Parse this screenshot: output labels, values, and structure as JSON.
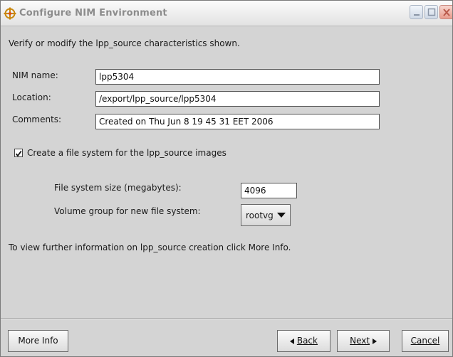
{
  "window": {
    "title": "Configure NIM Environment",
    "app_icon": "nim-icon",
    "controls": {
      "minimize": "minimize-icon",
      "maximize": "maximize-icon",
      "close": "close-icon"
    }
  },
  "instruction": "Verify or modify the lpp_source characteristics shown.",
  "form": {
    "nim_name_label": "NIM name:",
    "nim_name_value": "lpp5304",
    "location_label": "Location:",
    "location_value": "/export/lpp_source/lpp5304",
    "comments_label": "Comments:",
    "comments_value": "Created on Thu Jun 8 19 45 31 EET 2006"
  },
  "filesystem": {
    "checkbox_label": "Create a file system for the lpp_source images",
    "checked": true,
    "size_label": "File system size (megabytes):",
    "size_value": "4096",
    "volume_group_label": "Volume group for new file system:",
    "volume_group_value": "rootvg"
  },
  "info_text": "To view further information on lpp_source creation click More Info.",
  "buttons": {
    "more_info": "More Info",
    "back": "Back",
    "next": "Next",
    "cancel": "Cancel"
  },
  "colors": {
    "background": "#d4d4d4",
    "title_text": "#8c8c8c",
    "icon_accent": "#c8860a"
  }
}
